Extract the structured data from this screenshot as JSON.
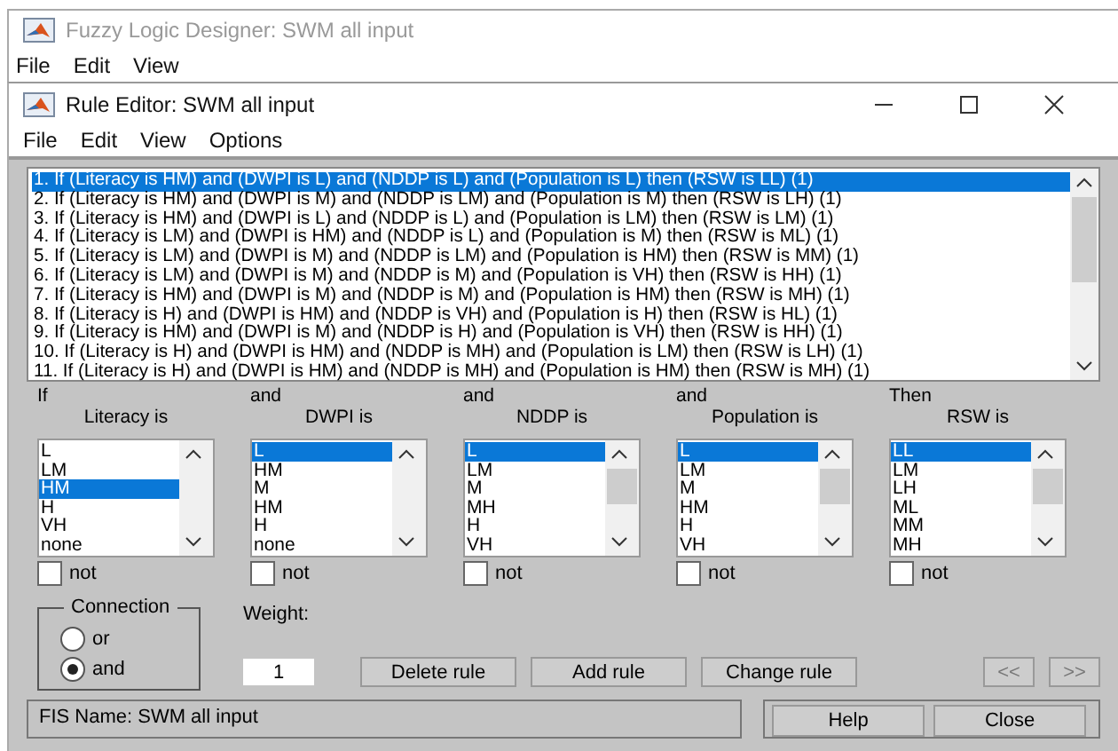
{
  "background_window": {
    "title": "Fuzzy Logic Designer: SWM all input",
    "menu": [
      "File",
      "Edit",
      "View"
    ]
  },
  "window": {
    "title": "Rule Editor: SWM all input",
    "menu": [
      "File",
      "Edit",
      "View",
      "Options"
    ]
  },
  "rules": [
    {
      "text": "1. If (Literacy is HM) and (DWPI is L) and (NDDP is L) and (Population is L) then (RSW is LL) (1)",
      "selected": true
    },
    {
      "text": "2. If (Literacy is HM) and (DWPI is M) and (NDDP is LM) and (Population is M) then (RSW is LH) (1)",
      "selected": false
    },
    {
      "text": "3. If (Literacy is HM) and (DWPI is L) and (NDDP is L) and (Population is LM) then (RSW is LM) (1)",
      "selected": false
    },
    {
      "text": "4. If (Literacy is LM) and (DWPI is HM) and (NDDP is L) and (Population is M) then (RSW is ML) (1)",
      "selected": false
    },
    {
      "text": "5. If (Literacy is LM) and (DWPI is M) and (NDDP is LM) and (Population is HM) then (RSW is MM) (1)",
      "selected": false
    },
    {
      "text": "6. If (Literacy is LM) and (DWPI is M) and (NDDP is M) and (Population is VH) then (RSW is HH) (1)",
      "selected": false
    },
    {
      "text": "7. If (Literacy is HM) and (DWPI is M) and (NDDP is M) and (Population is HM) then (RSW is MH) (1)",
      "selected": false
    },
    {
      "text": "8. If (Literacy is H) and (DWPI is HM) and (NDDP is VH) and (Population is H) then (RSW is HL) (1)",
      "selected": false
    },
    {
      "text": "9. If (Literacy is HM) and (DWPI is M) and (NDDP is H) and (Population is VH) then (RSW is HH) (1)",
      "selected": false
    },
    {
      "text": "10. If (Literacy is H) and (DWPI is HM) and (NDDP is MH) and (Population is LM) then (RSW is LH) (1)",
      "selected": false
    },
    {
      "text": "11. If (Literacy is H) and (DWPI is HM) and (NDDP is MH) and (Population is HM) then (RSW is MH) (1)",
      "selected": false
    }
  ],
  "variables": [
    {
      "prefix": "If",
      "label": "Literacy is",
      "not": false,
      "items": [
        {
          "text": "L",
          "selected": false
        },
        {
          "text": "LM",
          "selected": false
        },
        {
          "text": "HM",
          "selected": true
        },
        {
          "text": "H",
          "selected": false
        },
        {
          "text": "VH",
          "selected": false
        },
        {
          "text": "none",
          "selected": false
        }
      ]
    },
    {
      "prefix": "and",
      "label": "DWPI is",
      "not": false,
      "items": [
        {
          "text": "L",
          "selected": true
        },
        {
          "text": "HM",
          "selected": false
        },
        {
          "text": "M",
          "selected": false
        },
        {
          "text": "HM",
          "selected": false
        },
        {
          "text": "H",
          "selected": false
        },
        {
          "text": "none",
          "selected": false
        }
      ]
    },
    {
      "prefix": "and",
      "label": "NDDP is",
      "not": false,
      "items": [
        {
          "text": "L",
          "selected": true
        },
        {
          "text": "LM",
          "selected": false
        },
        {
          "text": "M",
          "selected": false
        },
        {
          "text": "MH",
          "selected": false
        },
        {
          "text": "H",
          "selected": false
        },
        {
          "text": "VH",
          "selected": false
        }
      ]
    },
    {
      "prefix": "and",
      "label": "Population is",
      "not": false,
      "items": [
        {
          "text": "L",
          "selected": true
        },
        {
          "text": "LM",
          "selected": false
        },
        {
          "text": "M",
          "selected": false
        },
        {
          "text": "HM",
          "selected": false
        },
        {
          "text": "H",
          "selected": false
        },
        {
          "text": "VH",
          "selected": false
        }
      ]
    },
    {
      "prefix": "Then",
      "label": "RSW is",
      "not": false,
      "items": [
        {
          "text": "LL",
          "selected": true
        },
        {
          "text": "LM",
          "selected": false
        },
        {
          "text": "LH",
          "selected": false
        },
        {
          "text": "ML",
          "selected": false
        },
        {
          "text": "MM",
          "selected": false
        },
        {
          "text": "MH",
          "selected": false
        }
      ]
    }
  ],
  "not_labels": [
    "not",
    "not",
    "not",
    "not",
    "not"
  ],
  "connection": {
    "label": "Connection",
    "options": [
      {
        "label": "or",
        "selected": false
      },
      {
        "label": "and",
        "selected": true
      }
    ]
  },
  "weight": {
    "label": "Weight:",
    "value": "1"
  },
  "buttons": [
    {
      "label": "Delete rule",
      "disabled": false
    },
    {
      "label": "Add rule",
      "disabled": false
    },
    {
      "label": "Change rule",
      "disabled": false
    }
  ],
  "nav_buttons": [
    {
      "label": "<<",
      "disabled": true
    },
    {
      "label": ">>",
      "disabled": true
    }
  ],
  "status": "FIS Name: SWM all input",
  "footer_buttons": [
    {
      "label": "Help",
      "disabled": false
    },
    {
      "label": "Close",
      "disabled": false
    }
  ]
}
